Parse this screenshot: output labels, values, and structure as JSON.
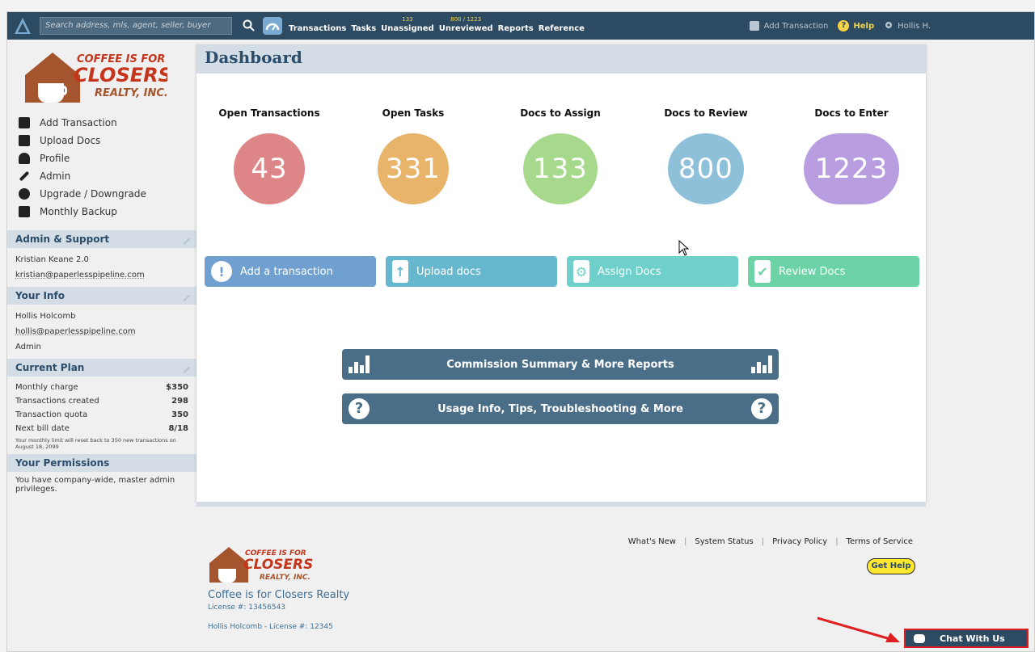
{
  "topnav": {
    "search_placeholder": "Search address, mls, agent, seller, buyer",
    "links": [
      {
        "label": "Transactions",
        "count": ""
      },
      {
        "label": "Tasks",
        "count": ""
      },
      {
        "label": "Unassigned",
        "count": "133"
      },
      {
        "label": "Unreviewed",
        "count": "800 / 1223"
      },
      {
        "label": "Reports",
        "count": ""
      },
      {
        "label": "Reference",
        "count": ""
      }
    ],
    "add_transaction": "Add Transaction",
    "help": "Help",
    "user": "Hollis H."
  },
  "sidebar": {
    "logo_text": [
      "COFFEE IS FOR",
      "CLOSERS",
      "REALTY, INC."
    ],
    "menu": [
      "Add Transaction",
      "Upload Docs",
      "Profile",
      "Admin",
      "Upgrade / Downgrade",
      "Monthly Backup"
    ],
    "admin_support": {
      "title": "Admin & Support",
      "name": "Kristian Keane 2.0",
      "email": "kristian@paperlesspipeline.com"
    },
    "your_info": {
      "title": "Your Info",
      "name": "Hollis Holcomb",
      "email": "hollis@paperlesspipeline.com",
      "role": "Admin"
    },
    "current_plan": {
      "title": "Current Plan",
      "rows": [
        {
          "label": "Monthly charge",
          "value": "$350"
        },
        {
          "label": "Transactions created",
          "value": "298"
        },
        {
          "label": "Transaction quota",
          "value": "350"
        },
        {
          "label": "Next bill date",
          "value": "8/18"
        }
      ],
      "note": "Your monthly limit will reset back to 350 new transactions on August 18, 2099"
    },
    "permissions": {
      "title": "Your Permissions",
      "text": "You have company-wide, master admin privileges."
    }
  },
  "main": {
    "title": "Dashboard",
    "stats": [
      {
        "label": "Open Transactions",
        "value": "43",
        "color": "#dd8587"
      },
      {
        "label": "Open Tasks",
        "value": "331",
        "color": "#e8b46a"
      },
      {
        "label": "Docs to Assign",
        "value": "133",
        "color": "#a7d98c"
      },
      {
        "label": "Docs to Review",
        "value": "800",
        "color": "#8fc0da"
      },
      {
        "label": "Docs to Enter",
        "value": "1223",
        "color": "#b89ee0"
      }
    ],
    "quick_buttons": [
      {
        "label": "Add a transaction",
        "color": "#6fa0cf"
      },
      {
        "label": "Upload docs",
        "color": "#66b8cf"
      },
      {
        "label": "Assign Docs",
        "color": "#6fcfca"
      },
      {
        "label": "Review Docs",
        "color": "#6bd3a6"
      }
    ],
    "reports_button": "Commission Summary & More Reports",
    "usage_button": "Usage Info, Tips, Troubleshooting & More"
  },
  "footer": {
    "links": [
      "What's New",
      "System Status",
      "Privacy Policy",
      "Terms of Service"
    ],
    "get_help": "Get Help",
    "company": "Coffee is for Closers Realty",
    "license": "License #: 13456543",
    "agent": "Hollis Holcomb - License #: 12345",
    "chat": "Chat With Us"
  }
}
